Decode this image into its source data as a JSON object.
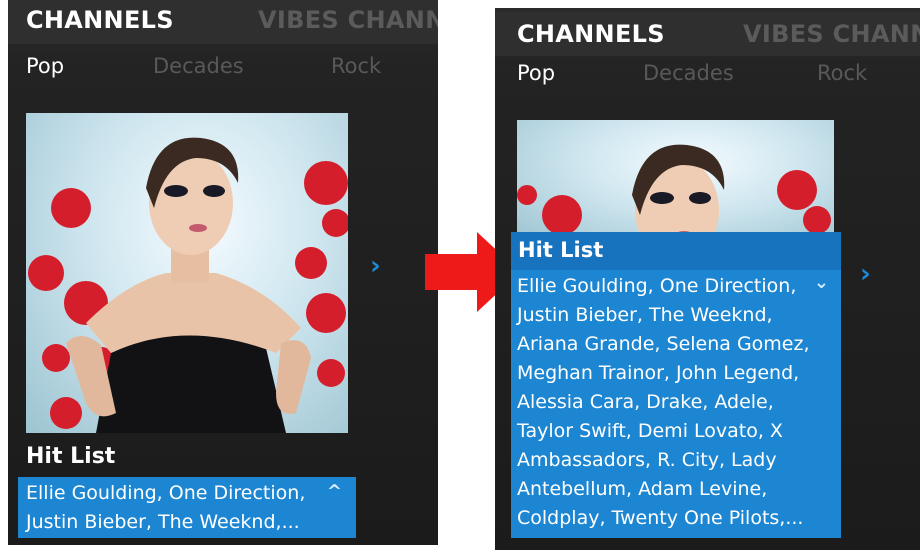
{
  "header": {
    "channels_label": "CHANNELS",
    "vibes_label": "VIBES CHANN"
  },
  "tabs": {
    "pop": "Pop",
    "decades": "Decades",
    "rock": "Rock"
  },
  "playlist": {
    "title": "Hit List",
    "collapsed_text": "Ellie Goulding, One Direction,\nJustin Bieber, The Weeknd,...",
    "expanded_text": "Ellie Goulding, One Direction,\nJustin Bieber, The Weeknd,\nAriana Grande, Selena Gomez,\nMeghan Trainor, John Legend,\nAlessia Cara, Drake, Adele,\nTaylor Swift, Demi Lovato, X\nAmbassadors, R. City, Lady\nAntebellum, Adam Levine,\nColdplay, Twenty One Pilots,..."
  },
  "icons": {
    "next": "›",
    "collapse": "^",
    "expand": "⌄"
  },
  "colors": {
    "accent": "#1d86d2",
    "arrow": "#ee1a1a",
    "background": "#1f1f1f"
  }
}
